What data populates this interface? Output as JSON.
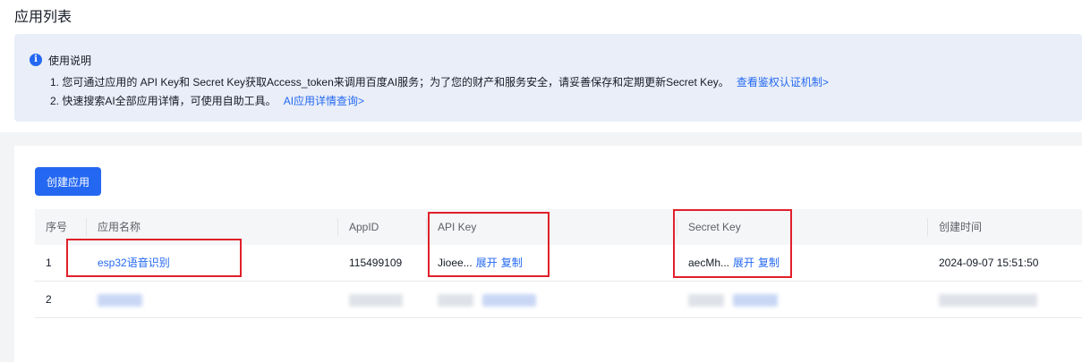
{
  "page": {
    "title": "应用列表"
  },
  "notice": {
    "icon": "info-icon",
    "title": "使用说明",
    "line1_text": "1. 您可通过应用的 API Key和 Secret Key获取Access_token来调用百度AI服务；为了您的财产和服务安全，请妥善保存和定期更新Secret Key。",
    "line1_link": "查看鉴权认证机制>",
    "line2_text": "2. 快速搜索AI全部应用详情，可使用自助工具。",
    "line2_link": "AI应用详情查询>"
  },
  "toolbar": {
    "create_label": "创建应用"
  },
  "table": {
    "headers": {
      "index": "序号",
      "name": "应用名称",
      "appid": "AppID",
      "apikey": "API Key",
      "secretkey": "Secret Key",
      "created": "创建时间"
    },
    "rows": [
      {
        "index": "1",
        "name": "esp32语音识别",
        "appid": "115499109",
        "apikey": "Jioee...",
        "secretkey": "aecMh...",
        "expand": "展开",
        "copy": "复制",
        "created": "2024-09-07 15:51:50"
      },
      {
        "index": "2"
      }
    ]
  },
  "colors": {
    "accent": "#2468f2",
    "highlight_box": "#e0202b"
  }
}
